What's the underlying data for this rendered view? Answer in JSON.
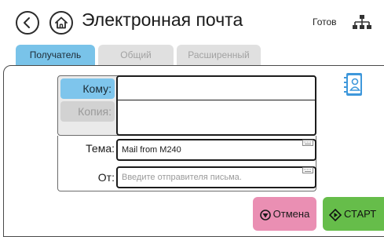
{
  "header": {
    "title": "Электронная почта",
    "status": "Готов"
  },
  "tabs": [
    {
      "label": "Получатель",
      "state": "active"
    },
    {
      "label": "Общий",
      "state": "disabled"
    },
    {
      "label": "Расширенный",
      "state": "disabled"
    }
  ],
  "form": {
    "to_label": "Кому:",
    "to_value": "",
    "cc_label": "Копия:",
    "cc_value": "",
    "subject_label": "Тема:",
    "subject_value": "Mail from M240",
    "from_label": "От:",
    "from_placeholder": "Введите отправителя письма."
  },
  "actions": {
    "cancel_label": "Отмена",
    "start_label": "СТАРТ"
  },
  "colors": {
    "tab_active": "#79c3e9",
    "tab_inactive": "#e0e0e0",
    "cancel": "#ea8fb3",
    "start": "#66bd4a"
  },
  "icons": [
    "back-icon",
    "home-icon",
    "network-icon",
    "keyboard-icon",
    "address-book-icon",
    "stop-icon",
    "start-icon"
  ]
}
